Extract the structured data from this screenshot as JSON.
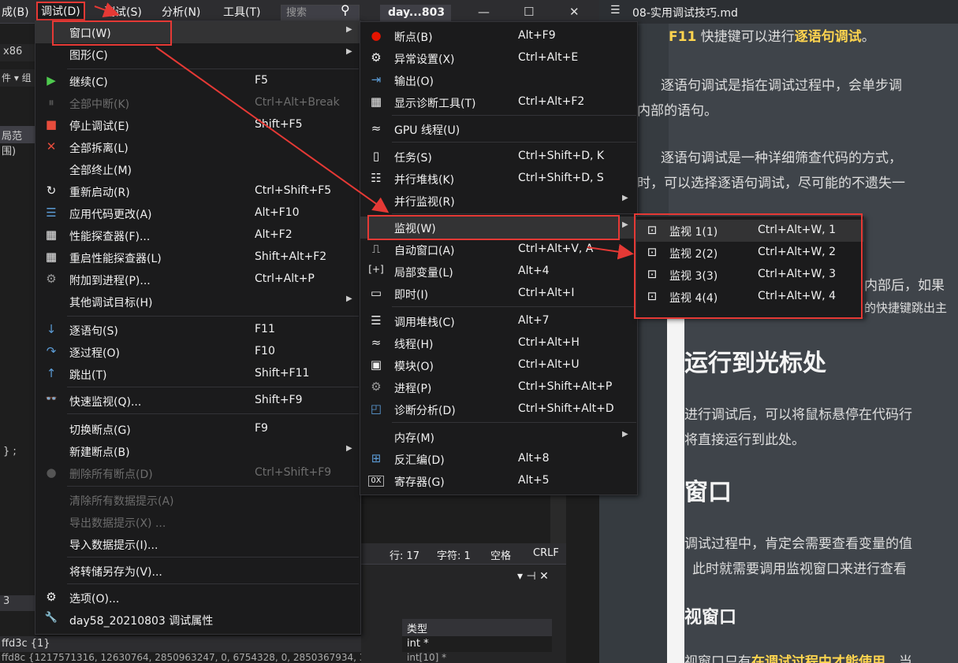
{
  "menubar": {
    "items": [
      "成(B)",
      "调试(D)",
      "测试(S)",
      "分析(N)",
      "工具(T)"
    ],
    "search_placeholder": "搜索",
    "project_tab": "day...803"
  },
  "left_strip": {
    "platform": "x86",
    "file_label": "件 ▾ 组",
    "scope": "局范围)",
    "brace": "} ;",
    "num": "3",
    "row1": "ffd3c {1}",
    "row2": "ffd8c {1217571316, 12630764, 2850963247, 0, 6754328, 0, 2850367934, 3869"
  },
  "statusbar": {
    "line": "行: 17",
    "char": "字符: 1",
    "space": "空格",
    "eol": "CRLF"
  },
  "panel": {
    "type_header": "类型",
    "row1_type": "int *",
    "row2_type": "int[10] *",
    "pin": "▾ ⊣ ✕"
  },
  "debug_menu": {
    "items": [
      {
        "label": "窗口(W)",
        "shortcut": "",
        "icon": "",
        "submenu": true,
        "disabled": false
      },
      {
        "label": "图形(C)",
        "shortcut": "",
        "icon": "",
        "submenu": true,
        "disabled": false
      },
      {
        "label": "继续(C)",
        "shortcut": "F5",
        "icon": "▶",
        "submenu": false,
        "disabled": false
      },
      {
        "label": "全部中断(K)",
        "shortcut": "Ctrl+Alt+Break",
        "icon": "⏸",
        "submenu": false,
        "disabled": true
      },
      {
        "label": "停止调试(E)",
        "shortcut": "Shift+F5",
        "icon": "■",
        "submenu": false,
        "disabled": false
      },
      {
        "label": "全部拆离(L)",
        "shortcut": "",
        "icon": "✕",
        "submenu": false,
        "disabled": false
      },
      {
        "label": "全部终止(M)",
        "shortcut": "",
        "icon": "",
        "submenu": false,
        "disabled": false
      },
      {
        "label": "重新启动(R)",
        "shortcut": "Ctrl+Shift+F5",
        "icon": "↻",
        "submenu": false,
        "disabled": false
      },
      {
        "label": "应用代码更改(A)",
        "shortcut": "Alt+F10",
        "icon": "☰",
        "submenu": false,
        "disabled": false
      },
      {
        "label": "性能探查器(F)...",
        "shortcut": "Alt+F2",
        "icon": "▦",
        "submenu": false,
        "disabled": false
      },
      {
        "label": "重启性能探查器(L)",
        "shortcut": "Shift+Alt+F2",
        "icon": "▦",
        "submenu": false,
        "disabled": false
      },
      {
        "label": "附加到进程(P)...",
        "shortcut": "Ctrl+Alt+P",
        "icon": "⚙",
        "submenu": false,
        "disabled": false
      },
      {
        "label": "其他调试目标(H)",
        "shortcut": "",
        "icon": "",
        "submenu": true,
        "disabled": false
      },
      {
        "label": "逐语句(S)",
        "shortcut": "F11",
        "icon": "↓",
        "submenu": false,
        "disabled": false
      },
      {
        "label": "逐过程(O)",
        "shortcut": "F10",
        "icon": "↷",
        "submenu": false,
        "disabled": false
      },
      {
        "label": "跳出(T)",
        "shortcut": "Shift+F11",
        "icon": "↑",
        "submenu": false,
        "disabled": false
      },
      {
        "label": "快速监视(Q)...",
        "shortcut": "Shift+F9",
        "icon": "👓",
        "submenu": false,
        "disabled": false
      },
      {
        "label": "切换断点(G)",
        "shortcut": "F9",
        "icon": "",
        "submenu": false,
        "disabled": false
      },
      {
        "label": "新建断点(B)",
        "shortcut": "",
        "icon": "",
        "submenu": true,
        "disabled": false
      },
      {
        "label": "删除所有断点(D)",
        "shortcut": "Ctrl+Shift+F9",
        "icon": "●",
        "submenu": false,
        "disabled": true
      },
      {
        "label": "清除所有数据提示(A)",
        "shortcut": "",
        "icon": "",
        "submenu": false,
        "disabled": true
      },
      {
        "label": "导出数据提示(X) ...",
        "shortcut": "",
        "icon": "",
        "submenu": false,
        "disabled": true
      },
      {
        "label": "导入数据提示(I)...",
        "shortcut": "",
        "icon": "",
        "submenu": false,
        "disabled": false
      },
      {
        "label": "将转储另存为(V)...",
        "shortcut": "",
        "icon": "",
        "submenu": false,
        "disabled": false
      },
      {
        "label": "选项(O)...",
        "shortcut": "",
        "icon": "⚙",
        "submenu": false,
        "disabled": false
      },
      {
        "label": "day58_20210803 调试属性",
        "shortcut": "",
        "icon": "🔧",
        "submenu": false,
        "disabled": false
      }
    ]
  },
  "window_menu": {
    "items": [
      {
        "label": "断点(B)",
        "shortcut": "Alt+F9",
        "icon": "●",
        "submenu": false
      },
      {
        "label": "异常设置(X)",
        "shortcut": "Ctrl+Alt+E",
        "icon": "⚙",
        "submenu": false
      },
      {
        "label": "输出(O)",
        "shortcut": "",
        "icon": "⇥",
        "submenu": false
      },
      {
        "label": "显示诊断工具(T)",
        "shortcut": "Ctrl+Alt+F2",
        "icon": "▦",
        "submenu": false
      },
      {
        "label": "GPU 线程(U)",
        "shortcut": "",
        "icon": "≈",
        "submenu": false
      },
      {
        "label": "任务(S)",
        "shortcut": "Ctrl+Shift+D, K",
        "icon": "▯",
        "submenu": false
      },
      {
        "label": "并行堆栈(K)",
        "shortcut": "Ctrl+Shift+D, S",
        "icon": "☷",
        "submenu": false
      },
      {
        "label": "并行监视(R)",
        "shortcut": "",
        "icon": "",
        "submenu": true
      },
      {
        "label": "监视(W)",
        "shortcut": "",
        "icon": "",
        "submenu": true
      },
      {
        "label": "自动窗口(A)",
        "shortcut": "Ctrl+Alt+V, A",
        "icon": "⎍",
        "submenu": false
      },
      {
        "label": "局部变量(L)",
        "shortcut": "Alt+4",
        "icon": "[+]",
        "submenu": false
      },
      {
        "label": "即时(I)",
        "shortcut": "Ctrl+Alt+I",
        "icon": "▭",
        "submenu": false
      },
      {
        "label": "调用堆栈(C)",
        "shortcut": "Alt+7",
        "icon": "☰",
        "submenu": false
      },
      {
        "label": "线程(H)",
        "shortcut": "Ctrl+Alt+H",
        "icon": "≈",
        "submenu": false
      },
      {
        "label": "模块(O)",
        "shortcut": "Ctrl+Alt+U",
        "icon": "▣",
        "submenu": false
      },
      {
        "label": "进程(P)",
        "shortcut": "Ctrl+Shift+Alt+P",
        "icon": "⚙",
        "submenu": false
      },
      {
        "label": "诊断分析(D)",
        "shortcut": "Ctrl+Shift+Alt+D",
        "icon": "◰",
        "submenu": false
      },
      {
        "label": "内存(M)",
        "shortcut": "",
        "icon": "",
        "submenu": true
      },
      {
        "label": "反汇编(D)",
        "shortcut": "Alt+8",
        "icon": "⊞",
        "submenu": false
      },
      {
        "label": "寄存器(G)",
        "shortcut": "Alt+5",
        "icon": "0X",
        "submenu": false
      }
    ]
  },
  "watch_menu": {
    "items": [
      {
        "label": "监视 1(1)",
        "shortcut": "Ctrl+Alt+W, 1"
      },
      {
        "label": "监视 2(2)",
        "shortcut": "Ctrl+Alt+W, 2"
      },
      {
        "label": "监视 3(3)",
        "shortcut": "Ctrl+Alt+W, 3"
      },
      {
        "label": "监视 4(4)",
        "shortcut": "Ctrl+Alt+W, 4"
      }
    ]
  },
  "markdown": {
    "filename": "08-实用调试技巧.md",
    "p0_key": "F11",
    "p0_text": " 快捷键可以进行",
    "p0_hl": "逐语句调试",
    "p0_end": "。",
    "p1": "逐语句调试是指在调试过程中，会单步调",
    "p1b": "内部的语句。",
    "p2": "逐语句调试是一种详细筛查代码的方式，",
    "p2b": "时，可以选择逐语句调试，尽可能的不遗失一",
    "p3": "内部后，如果",
    "p3b": "的快捷键跳出主",
    "h1": "运行到光标处",
    "p4": "进行调试后，可以将鼠标悬停在代码行",
    "p4b": "将直接运行到此处。",
    "h2": "窗口",
    "p5": "调试过程中，肯定会需要查看变量的值",
    "p5b": "此时就需要调用监视窗口来进行查看",
    "h3": "视窗口",
    "p6a": "视窗口只有",
    "p6hl": "在调试过程中才能使用",
    "p6b": "，当"
  },
  "colors": {
    "accent_red": "#e53935",
    "highlight": "#ffd54f",
    "menu_bg": "#1b1b1c",
    "hover_bg": "#333334"
  }
}
